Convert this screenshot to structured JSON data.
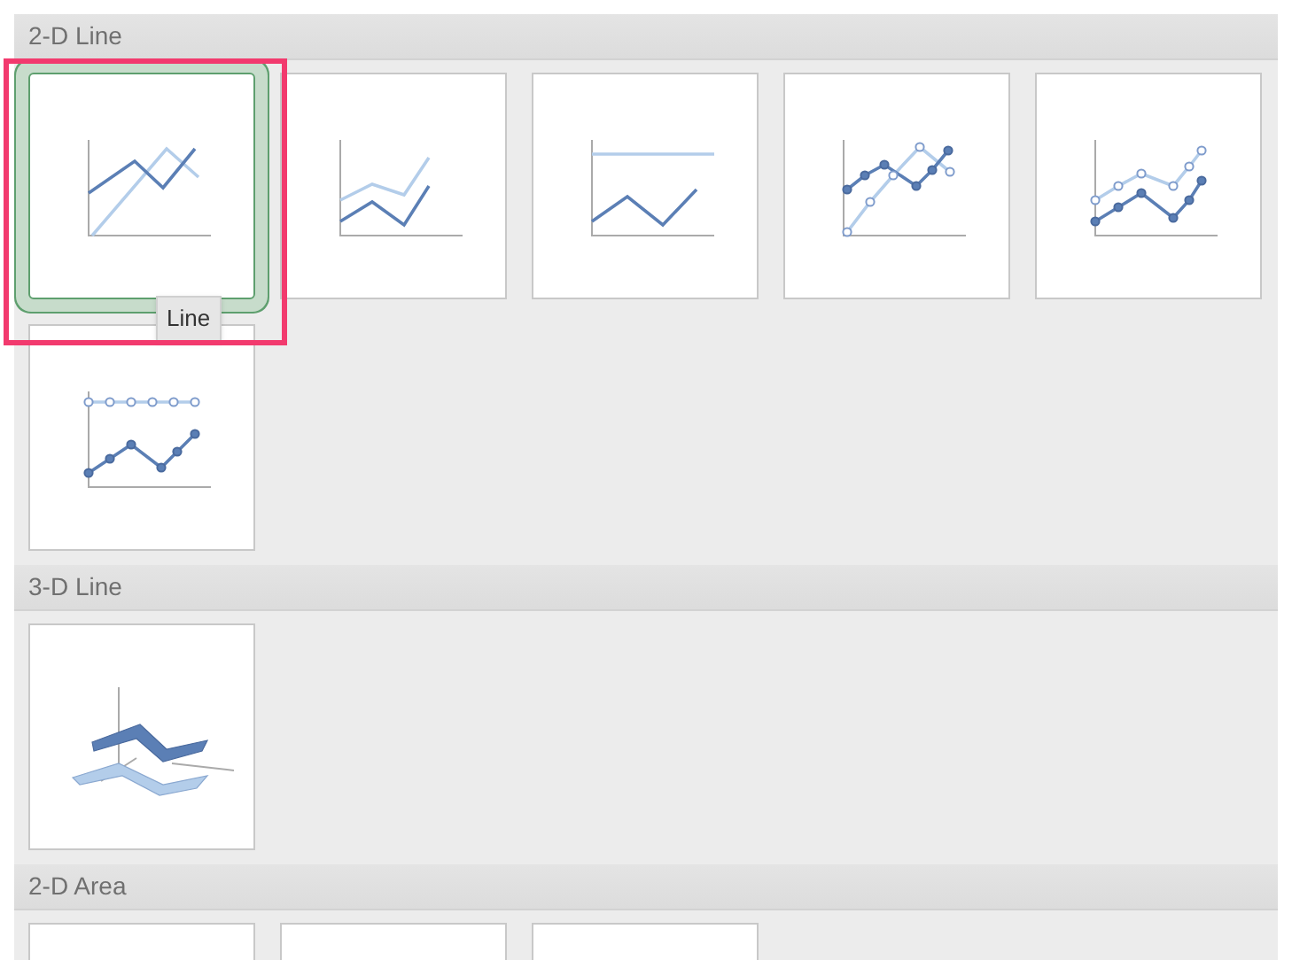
{
  "sections": [
    {
      "title": "2-D Line",
      "tiles": [
        {
          "kind": "line",
          "selected": true,
          "tooltip": "Line"
        },
        {
          "kind": "stacked-line",
          "selected": false
        },
        {
          "kind": "percent-stacked-line",
          "selected": false
        },
        {
          "kind": "line-markers",
          "selected": false
        },
        {
          "kind": "stacked-line-markers",
          "selected": false
        },
        {
          "kind": "percent-stacked-line-markers",
          "selected": false
        }
      ]
    },
    {
      "title": "3-D Line",
      "tiles": [
        {
          "kind": "line-3d",
          "selected": false
        }
      ]
    },
    {
      "title": "2-D Area",
      "tiles": [
        {
          "kind": "area",
          "selected": false
        },
        {
          "kind": "area",
          "selected": false
        },
        {
          "kind": "area",
          "selected": false
        }
      ]
    }
  ]
}
